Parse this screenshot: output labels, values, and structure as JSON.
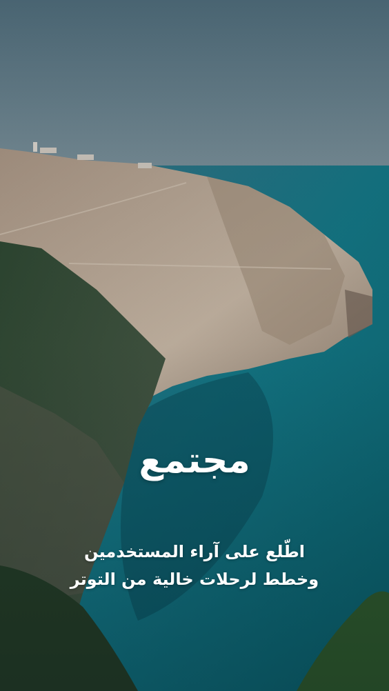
{
  "onboarding": {
    "title": "مجتمع",
    "subtitle_line1": "اطّلع على آراء المستخدمين",
    "subtitle_line2": "وخطط لرحلات خالية من التوتر"
  },
  "colors": {
    "sky": "#5d7683",
    "sea": "#0f6d78",
    "cliff": "#b9a894",
    "vegetation": "#2f4a2e",
    "text": "#ffffff"
  }
}
